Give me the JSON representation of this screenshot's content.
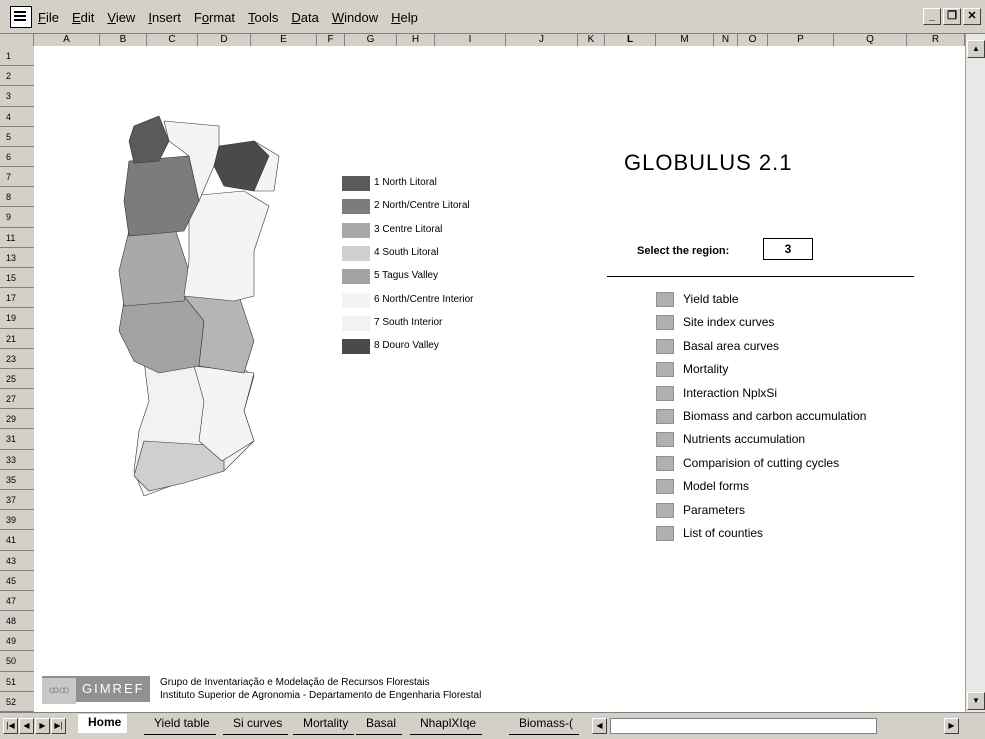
{
  "menu": {
    "items": [
      "File",
      "Edit",
      "View",
      "Insert",
      "Format",
      "Tools",
      "Data",
      "Window",
      "Help"
    ],
    "underline": [
      "F",
      "E",
      "V",
      "I",
      "o",
      "T",
      "D",
      "W",
      "H"
    ]
  },
  "window_controls": [
    "_",
    "̲",
    "X"
  ],
  "columns": [
    "A",
    "B",
    "C",
    "D",
    "E",
    "F",
    "G",
    "H",
    "I",
    "J",
    "K",
    "L",
    "M",
    "N",
    "O",
    "P",
    "Q",
    "R"
  ],
  "rows": [
    "1",
    "2",
    "3",
    "4",
    "5",
    "6",
    "7",
    "8",
    "9",
    "11",
    "13",
    "15",
    "17",
    "19",
    "21",
    "23",
    "25",
    "27",
    "29",
    "31",
    "33",
    "35",
    "37",
    "39",
    "41",
    "43",
    "45",
    "47",
    "48",
    "49",
    "50",
    "51",
    "52"
  ],
  "legend": [
    {
      "label": "1 North Litoral",
      "color": "#5a5a5a"
    },
    {
      "label": "2 North/Centre Litoral",
      "color": "#7c7c7c"
    },
    {
      "label": "3 Centre Litoral",
      "color": "#a9a9a9"
    },
    {
      "label": "4 South Litoral",
      "color": "#cfcfcf"
    },
    {
      "label": "5 Tagus Valley",
      "color": "#a3a3a3"
    },
    {
      "label": "6 North/Centre Interior",
      "color": "#f4f4f4"
    },
    {
      "label": "7 South Interior",
      "color": "#f2f2f2"
    },
    {
      "label": "8 Douro Valley",
      "color": "#4a4a4a"
    }
  ],
  "title": "GLOBULUS 2.1",
  "select": {
    "label": "Select the region:",
    "value": "3"
  },
  "nav_items": [
    "Yield table",
    "Site index curves",
    "Basal area curves",
    "Mortality",
    "Interaction NplxSi",
    "Biomass and carbon accumulation",
    "Nutrients accumulation",
    "Comparision of cutting cycles",
    "Model forms",
    "Parameters",
    "List of counties"
  ],
  "footer": {
    "logo_text": "GIMREF",
    "line1": "Grupo de Inventariação e Modelação de Recursos Florestais",
    "line2": "Instituto Superior de Agronomia  - Departamento de Engenharia Florestal"
  },
  "tabs": [
    "Home",
    "Yield table",
    "Si curves",
    "Mortality",
    "Basal",
    "NhaplXIqe",
    "Biomass-("
  ]
}
